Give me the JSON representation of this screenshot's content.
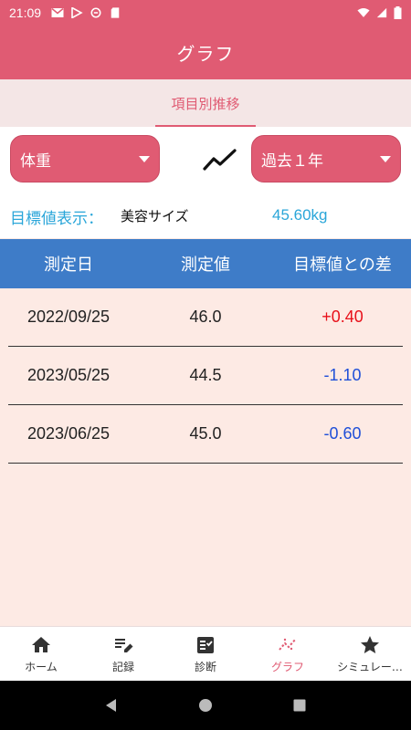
{
  "status_bar": {
    "time": "21:09",
    "icons": [
      "gmail-icon",
      "play-store-icon",
      "vpn-icon",
      "sd-card-icon",
      "wifi-icon",
      "signal-icon",
      "battery-icon"
    ]
  },
  "app_bar": {
    "title": "グラフ"
  },
  "tabs": [
    {
      "label": "項目別推移",
      "active": true
    }
  ],
  "controls": {
    "item_select": {
      "value": "体重"
    },
    "period_select": {
      "value": "過去１年"
    },
    "chart_toggle_icon": "line-chart-icon"
  },
  "target": {
    "label": "目標値表示：",
    "name": "美容サイズ",
    "value": "45.60kg"
  },
  "table": {
    "headers": [
      "測定日",
      "測定値",
      "目標値との差"
    ],
    "rows": [
      {
        "date": "2022/09/25",
        "value": "46.0",
        "diff": "+0.40"
      },
      {
        "date": "2023/05/25",
        "value": "44.5",
        "diff": "-1.10"
      },
      {
        "date": "2023/06/25",
        "value": "45.0",
        "diff": "-0.60"
      }
    ]
  },
  "bottom_nav": [
    {
      "label": "ホーム",
      "icon": "home-icon",
      "active": false
    },
    {
      "label": "記録",
      "icon": "edit-icon",
      "active": false
    },
    {
      "label": "診断",
      "icon": "checklist-icon",
      "active": false
    },
    {
      "label": "グラフ",
      "icon": "graph-icon",
      "active": true
    },
    {
      "label": "シミュレー…",
      "icon": "star-icon",
      "active": false
    }
  ],
  "colors": {
    "primary": "#e05b73",
    "header_blue": "#3e7cc8",
    "accent_cyan": "#2aa6d9",
    "positive_red": "#e8101a",
    "negative_blue": "#1f4fd8",
    "background": "#fdeae4"
  }
}
